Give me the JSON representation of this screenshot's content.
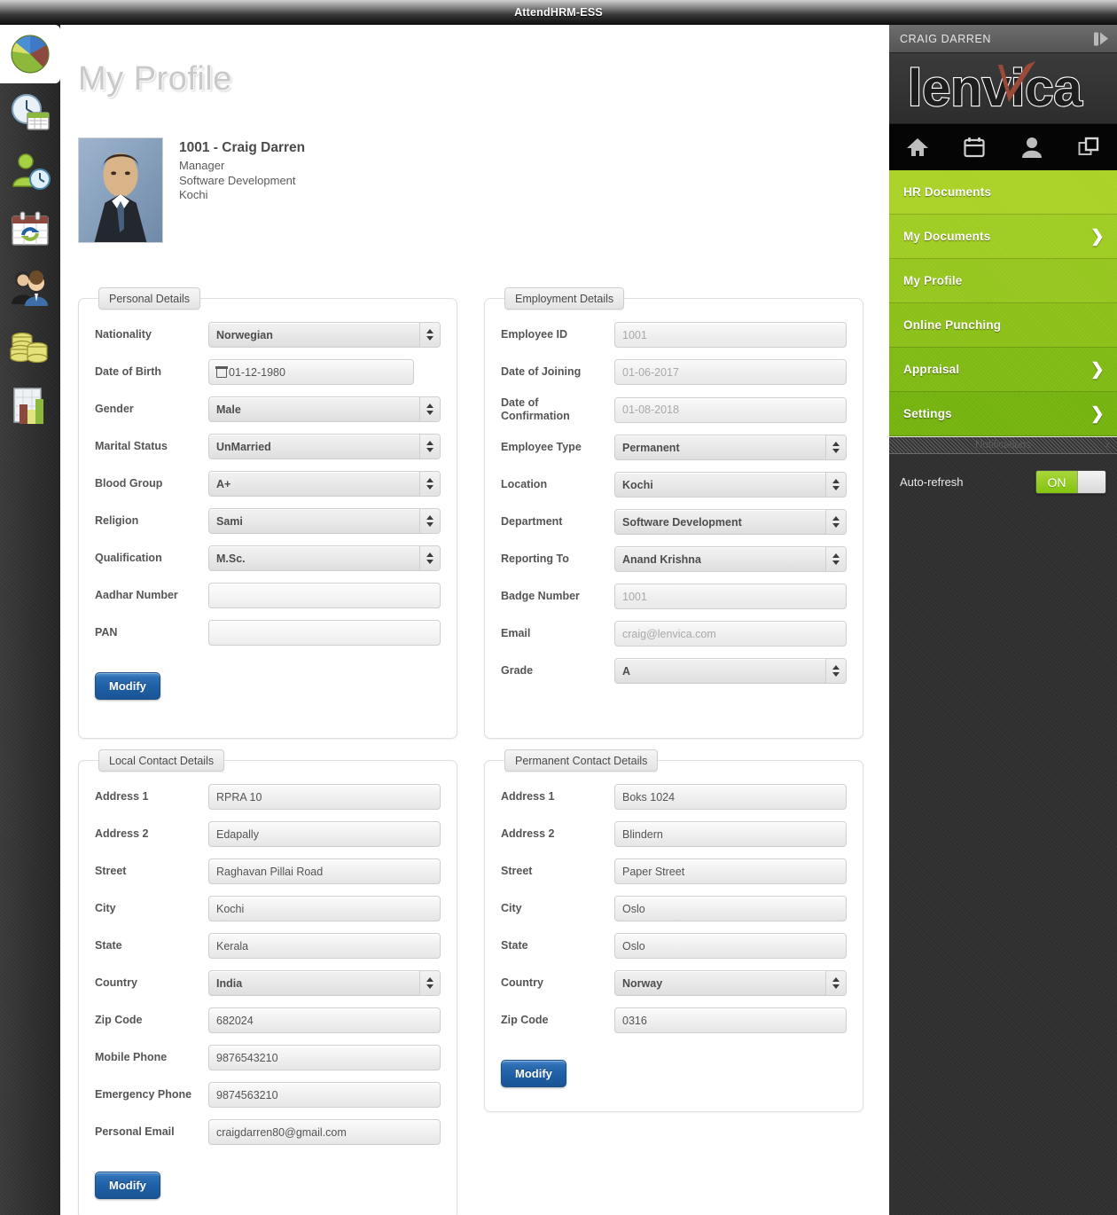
{
  "window": {
    "title": "AttendHRM-ESS"
  },
  "page": {
    "title": "My Profile"
  },
  "rail": {
    "items": [
      {
        "icon": "pie-chart-icon",
        "active": true
      },
      {
        "icon": "clock-calendar-icon",
        "active": false
      },
      {
        "icon": "person-clock-icon",
        "active": false
      },
      {
        "icon": "calendar-sync-icon",
        "active": false
      },
      {
        "icon": "people-icon",
        "active": false
      },
      {
        "icon": "coins-icon",
        "active": false
      },
      {
        "icon": "report-chart-icon",
        "active": false
      }
    ]
  },
  "employee": {
    "name": "1001 - Craig Darren",
    "designation": "Manager",
    "department": "Software Development",
    "location": "Kochi"
  },
  "panels": {
    "personal": {
      "legend": "Personal Details",
      "modify_label": "Modify",
      "fields": [
        {
          "label": "Nationality",
          "value": "Norwegian",
          "type": "select"
        },
        {
          "label": "Date of Birth",
          "value": "01-12-1980",
          "type": "date"
        },
        {
          "label": "Gender",
          "value": "Male",
          "type": "select"
        },
        {
          "label": "Marital Status",
          "value": "UnMarried",
          "type": "select"
        },
        {
          "label": "Blood Group",
          "value": "A+",
          "type": "select"
        },
        {
          "label": "Religion",
          "value": "Sami",
          "type": "select"
        },
        {
          "label": "Qualification",
          "value": "M.Sc.",
          "type": "select"
        },
        {
          "label": "Aadhar Number",
          "value": "",
          "type": "text"
        },
        {
          "label": "PAN",
          "value": "",
          "type": "text"
        }
      ]
    },
    "employment": {
      "legend": "Employment Details",
      "fields": [
        {
          "label": "Employee ID",
          "value": "1001",
          "type": "text",
          "disabled": true
        },
        {
          "label": "Date of Joining",
          "value": "01-06-2017",
          "type": "text",
          "disabled": true
        },
        {
          "label": "Date of Confirmation",
          "value": "01-08-2018",
          "type": "text",
          "disabled": true
        },
        {
          "label": "Employee Type",
          "value": "Permanent",
          "type": "select"
        },
        {
          "label": "Location",
          "value": "Kochi",
          "type": "select"
        },
        {
          "label": "Department",
          "value": "Software Development",
          "type": "select"
        },
        {
          "label": "Reporting To",
          "value": "Anand Krishna",
          "type": "select"
        },
        {
          "label": "Badge Number",
          "value": "1001",
          "type": "text",
          "disabled": true
        },
        {
          "label": "Email",
          "value": "craig@lenvica.com",
          "type": "text",
          "disabled": true
        },
        {
          "label": "Grade",
          "value": "A",
          "type": "select"
        }
      ]
    },
    "local_contact": {
      "legend": "Local Contact Details",
      "modify_label": "Modify",
      "fields": [
        {
          "label": "Address 1",
          "value": "RPRA 10",
          "type": "text"
        },
        {
          "label": "Address 2",
          "value": "Edapally",
          "type": "text"
        },
        {
          "label": "Street",
          "value": "Raghavan Pillai Road",
          "type": "text"
        },
        {
          "label": "City",
          "value": "Kochi",
          "type": "text"
        },
        {
          "label": "State",
          "value": "Kerala",
          "type": "text"
        },
        {
          "label": "Country",
          "value": "India",
          "type": "select"
        },
        {
          "label": "Zip Code",
          "value": "682024",
          "type": "text"
        },
        {
          "label": "Mobile Phone",
          "value": "9876543210",
          "type": "text"
        },
        {
          "label": "Emergency Phone",
          "value": "9874563210",
          "type": "text"
        },
        {
          "label": "Personal Email",
          "value": "craigdarren80@gmail.com",
          "type": "text"
        }
      ]
    },
    "permanent_contact": {
      "legend": "Permanent Contact Details",
      "modify_label": "Modify",
      "fields": [
        {
          "label": "Address 1",
          "value": "Boks 1024",
          "type": "text"
        },
        {
          "label": "Address 2",
          "value": "Blindern",
          "type": "text"
        },
        {
          "label": "Street",
          "value": "Paper Street",
          "type": "text"
        },
        {
          "label": "City",
          "value": "Oslo",
          "type": "text"
        },
        {
          "label": "State",
          "value": "Oslo",
          "type": "text"
        },
        {
          "label": "Country",
          "value": "Norway",
          "type": "select"
        },
        {
          "label": "Zip Code",
          "value": "0316",
          "type": "text"
        }
      ]
    }
  },
  "right": {
    "user": "CRAIG DARREN",
    "collapse_icon": "collapse-panel-icon",
    "logo_text": "lenvica",
    "nav_icons": [
      {
        "name": "home-icon"
      },
      {
        "name": "calendar-icon"
      },
      {
        "name": "person-icon"
      },
      {
        "name": "windows-copy-icon"
      }
    ],
    "menu": [
      {
        "label": "HR Documents",
        "chevron": false,
        "color": "#a9d126"
      },
      {
        "label": "My Documents",
        "chevron": true,
        "color": "#9fcc21"
      },
      {
        "label": "My Profile",
        "chevron": false,
        "color": "#95c61d"
      },
      {
        "label": "Online Punching",
        "chevron": false,
        "color": "#8bc017"
      },
      {
        "label": "Appraisal",
        "chevron": true,
        "color": "#7fb913"
      },
      {
        "label": "Settings",
        "chevron": true,
        "color": "#74b20e"
      }
    ],
    "notifications": {
      "title": "Notifications",
      "close_label": "x",
      "autorefresh_label": "Auto-refresh",
      "toggle_state": "ON"
    }
  },
  "colors": {
    "accent_green": "#8bc017",
    "button_blue": "#1f5fa4",
    "panel_border": "#dedede"
  }
}
